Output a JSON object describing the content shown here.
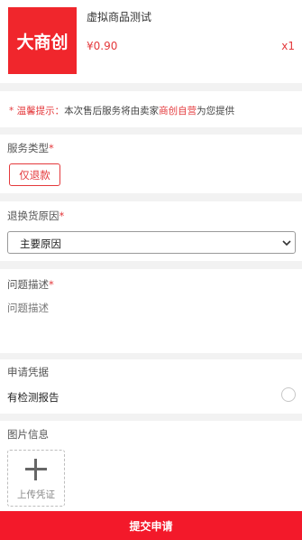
{
  "product": {
    "thumbnail_text": "大商创",
    "name": "虚拟商品测试",
    "price": "¥0.90",
    "quantity": "x1"
  },
  "notice": {
    "label": "* 温馨提示：",
    "text_before": "本次售后服务将由卖家",
    "seller": "商创自营",
    "text_after": "为您提供"
  },
  "service_type": {
    "label": "服务类型",
    "required_mark": "*",
    "option": "仅退款"
  },
  "return_reason": {
    "label": "退换货原因",
    "required_mark": "*",
    "selected": "主要原因"
  },
  "problem_desc": {
    "label": "问题描述",
    "required_mark": "*",
    "placeholder": "问题描述"
  },
  "voucher": {
    "label": "申请凭据",
    "option": "有检测报告"
  },
  "images": {
    "label": "图片信息",
    "upload_label": "上传凭证"
  },
  "submit_label": "提交申请",
  "colors": {
    "accent": "#e4393c",
    "submit_bg": "#f3192a",
    "thumbnail_bg": "#f0262c"
  }
}
